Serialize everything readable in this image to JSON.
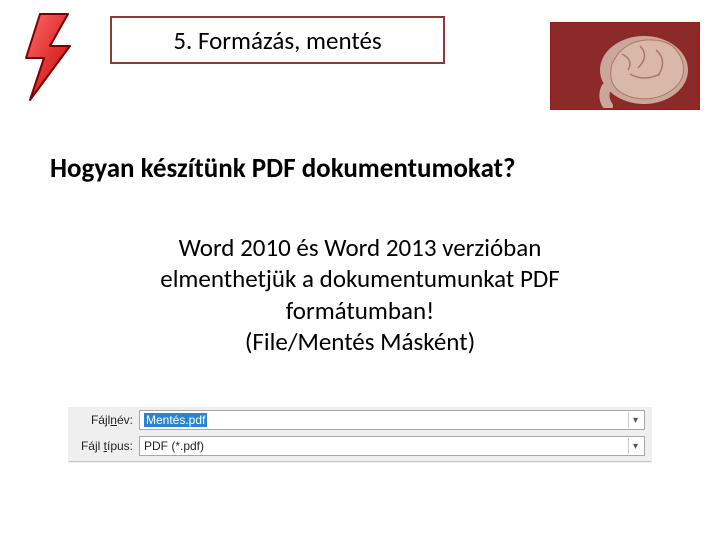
{
  "header": {
    "title": "5. Formázás, mentés"
  },
  "content": {
    "subtitle": "Hogyan készítünk PDF dokumentumokat?",
    "body_line1": "Word 2010 és Word 2013 verzióban",
    "body_line2": "elmenthetjük a dokumentumunkat PDF",
    "body_line3": "formátumban!",
    "body_line4": "(File/Mentés Másként)"
  },
  "saveas": {
    "filename_label_pre": "Fájl",
    "filename_label_u": "n",
    "filename_label_post": "év:",
    "filename_value": "Mentés.pdf",
    "filetype_label_pre": "Fájl ",
    "filetype_label_u": "t",
    "filetype_label_post": "ípus:",
    "filetype_value": "PDF (*.pdf)"
  },
  "icons": {
    "lightning": "lightning-icon",
    "brain": "brain-image",
    "dropdown": "chevron-down-icon"
  }
}
